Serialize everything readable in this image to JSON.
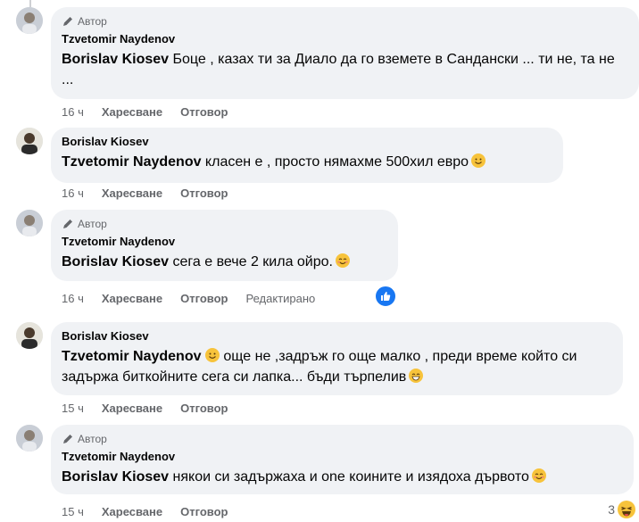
{
  "comments": [
    {
      "badge": "Автор",
      "author": "Tzvetomir Naydenov",
      "mention": "Borislav Kiosev",
      "text": " Боце , казах ти за Диало да го вземете в Сандански ... ти не, та не ...",
      "time": "16 ч",
      "like": "Харесване",
      "reply": "Отговор"
    },
    {
      "author": "Borislav Kiosev",
      "mention": "Tzvetomir Naydenov",
      "text": " класен е , просто нямахме 500хил евро",
      "time": "16 ч",
      "like": "Харесване",
      "reply": "Отговор"
    },
    {
      "badge": "Автор",
      "author": "Tzvetomir Naydenov",
      "mention": "Borislav Kiosev",
      "text": " сега е вече 2 кила ойро.",
      "time": "16 ч",
      "like": "Харесване",
      "reply": "Отговор",
      "edited": "Редактирано"
    },
    {
      "author": "Borislav Kiosev",
      "mention": "Tzvetomir Naydenov",
      "text": " още не ,задръж го още малко , преди време който си задържа биткойните сега си лапка... бъди търпелив",
      "time": "15 ч",
      "like": "Харесване",
      "reply": "Отговор"
    },
    {
      "badge": "Автор",
      "author": "Tzvetomir Naydenov",
      "mention": "Borislav Kiosev",
      "text": " някои си задържаха и one коините и изядоха дървото",
      "time": "15 ч",
      "like": "Харесване",
      "reply": "Отговор",
      "reaction_count": "3"
    }
  ],
  "colors": {
    "bubble": "#f0f2f5",
    "meta": "#65676b",
    "like_blue": "#1877f2"
  }
}
